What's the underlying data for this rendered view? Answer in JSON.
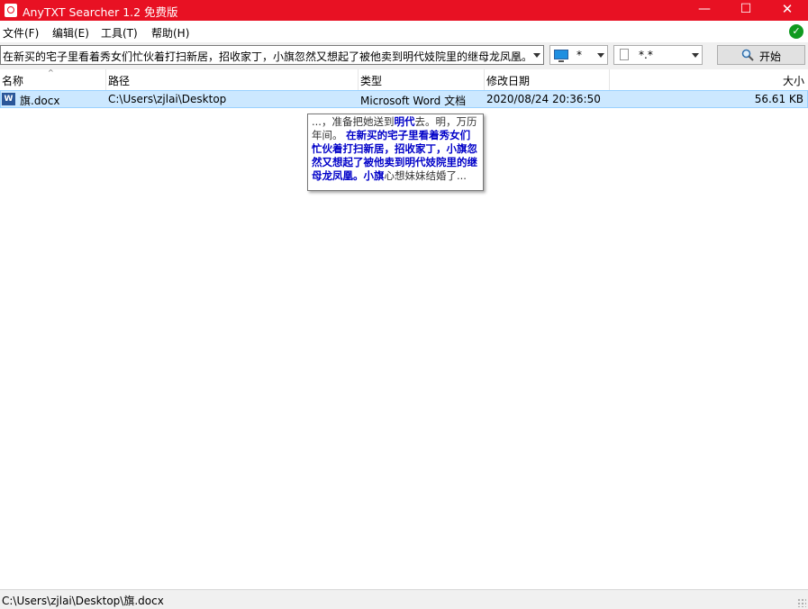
{
  "window": {
    "title": "AnyTXT Searcher 1.2 免费版",
    "minimize_glyph": "—",
    "maximize_glyph": "☐",
    "close_glyph": "✕",
    "accent_color": "#e81123"
  },
  "menu": {
    "items": [
      {
        "label": "文件(F)"
      },
      {
        "label": "编辑(E)"
      },
      {
        "label": "工具(T)"
      },
      {
        "label": "帮助(H)"
      }
    ],
    "status_icon": "check-circle-icon",
    "status_glyph": "✓"
  },
  "toolbar": {
    "search_query": "在新买的宅子里看着秀女们忙伙着打扫新居，招收家丁，小旗忽然又想起了被他卖到明代妓院里的继母龙凤凰。",
    "drive_value": "*",
    "filetype_value": "*.*",
    "start_label": "开始"
  },
  "table": {
    "columns": [
      "名称",
      "路径",
      "类型",
      "修改日期",
      "大小"
    ],
    "rows": [
      {
        "name": "旗.docx",
        "path": "C:\\Users\\zjlai\\Desktop",
        "type": "Microsoft Word 文档",
        "modified": "2020/08/24  20:36:50",
        "size": "56.61 KB",
        "icon": "word-doc-icon"
      }
    ]
  },
  "tooltip": {
    "segments": [
      {
        "text": "...，准备把她送到",
        "highlight": false
      },
      {
        "text": "明代",
        "highlight": true
      },
      {
        "text": "去。明，万历年间。 ",
        "highlight": false
      },
      {
        "text": "在新买的宅子里看着秀女们忙伙着打扫新居，招收家丁，小旗忽然又想起了被他卖到明代妓院里的继母龙凤凰。",
        "highlight": true
      },
      {
        "text": "小旗",
        "highlight": true
      },
      {
        "text": "心想妹妹结婚了...",
        "highlight": false
      }
    ],
    "highlight_color": "#0000c8"
  },
  "statusbar": {
    "path": "C:\\Users\\zjlai\\Desktop\\旗.docx"
  }
}
